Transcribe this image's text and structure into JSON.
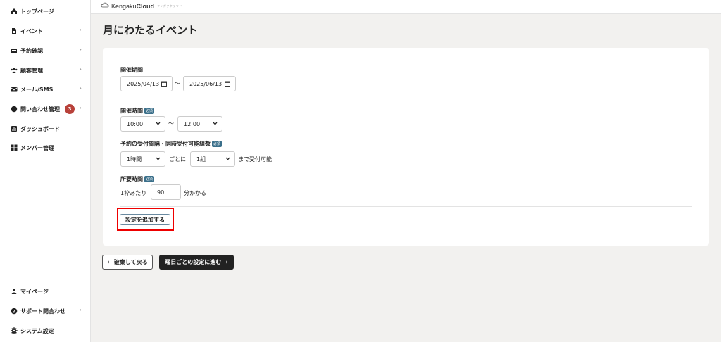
{
  "sidebar": {
    "items": [
      {
        "label": "トップページ",
        "icon": "home-icon",
        "chevron": false
      },
      {
        "label": "イベント",
        "icon": "document-icon",
        "chevron": true
      },
      {
        "label": "予約確認",
        "icon": "calendar-icon",
        "chevron": true
      },
      {
        "label": "顧客管理",
        "icon": "users-icon",
        "chevron": true
      },
      {
        "label": "メール/SMS",
        "icon": "mail-icon",
        "chevron": true
      },
      {
        "label": "問い合わせ管理",
        "icon": "chat-icon",
        "chevron": true,
        "badge": "3"
      },
      {
        "label": "ダッシュボード",
        "icon": "chart-icon",
        "chevron": false
      },
      {
        "label": "メンバー管理",
        "icon": "grid-icon",
        "chevron": false
      }
    ],
    "bottom_items": [
      {
        "label": "マイページ",
        "icon": "user-icon",
        "chevron": false
      },
      {
        "label": "サポート問合わせ",
        "icon": "help-icon",
        "chevron": true
      },
      {
        "label": "システム設定",
        "icon": "gear-icon",
        "chevron": false
      }
    ],
    "chevron_glyph": "›"
  },
  "header": {
    "brand_prefix": "Kengaku",
    "brand_suffix": "Cloud",
    "tagline": "ケンガククラウド"
  },
  "page": {
    "title": "月にわたるイベント"
  },
  "form": {
    "period_label": "開催期間",
    "start_date": "2025/04/13",
    "end_date": "2025/06/13",
    "range_sep": "〜",
    "time_label": "開催時間",
    "required_badge": "必須",
    "start_time": "10:00",
    "end_time": "12:00",
    "interval_label": "予約の受付間隔・同時受付可能組数",
    "interval_value": "1時間",
    "interval_suffix": "ごとに",
    "groups_value": "1組",
    "groups_suffix": "まで受付可能",
    "duration_label": "所要時間",
    "duration_prefix": "1枠あたり",
    "duration_value": "90",
    "duration_suffix": "分かかる",
    "add_button": "設定を追加する"
  },
  "footer_buttons": {
    "back": "← 破棄して戻る",
    "next": "曜日ごとの設定に進む →"
  },
  "colors": {
    "badge": "#b8413a",
    "required": "#3a6f8a",
    "highlight": "#ee0000",
    "primary_button": "#222222"
  }
}
